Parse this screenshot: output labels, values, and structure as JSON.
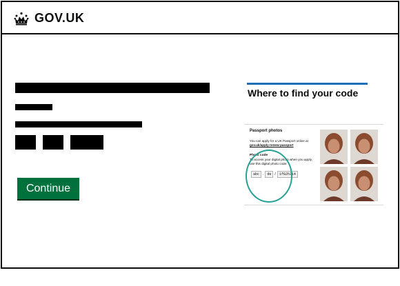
{
  "header": {
    "logo_text": "GOV.UK",
    "logo_icon": "crown-icon"
  },
  "main": {
    "continue_label": "Continue"
  },
  "sidebar": {
    "title": "Where to find your code",
    "example": {
      "heading": "Passport photos",
      "line1": "You can apply for a UK Passport online at",
      "link": "gov.uk/apply-renew-passport",
      "subheading": "Photo code",
      "line2": "To access your digital photo when you apply,",
      "line3": "use this digital photo code:",
      "code_part1": "abc",
      "code_part2": "de",
      "code_part3": "1fG2h3i4",
      "sep1": ".",
      "sep2": "/"
    }
  },
  "colors": {
    "button_green": "#00703c",
    "link_blue": "#1d70b8",
    "highlight_teal": "#28a197"
  }
}
